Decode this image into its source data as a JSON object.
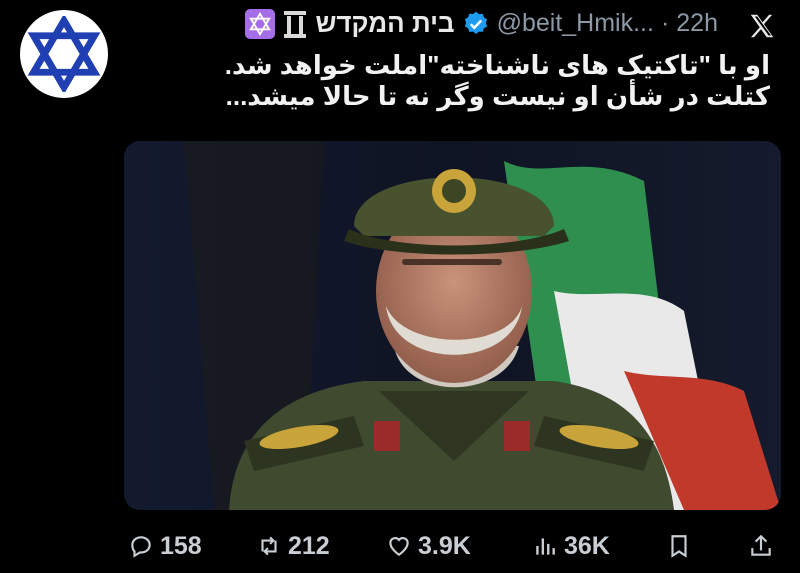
{
  "tweet": {
    "display_name": "בית המקדש",
    "handle": "@beit_Hmik...",
    "separator": "·",
    "time": "22h",
    "lines": [
      "او با \"تاکتیک های ناشناخته\"املت خواهد شد.",
      "کتلت در شأن او نیست وگر نه تا حالا میشد..."
    ]
  },
  "metrics": {
    "replies": "158",
    "reposts": "212",
    "likes": "3.9K",
    "views": "36K"
  },
  "icons": {
    "avatar": "star-of-david-icon",
    "verified": "verified-badge-icon",
    "platform": "x-logo-icon"
  },
  "colors": {
    "background": "#000000",
    "text": "#e7e9ea",
    "muted": "#8b98a5",
    "verified": "#1d9bf0",
    "avatar_star": "#1f3fb3",
    "badge": "#a56ee8"
  }
}
